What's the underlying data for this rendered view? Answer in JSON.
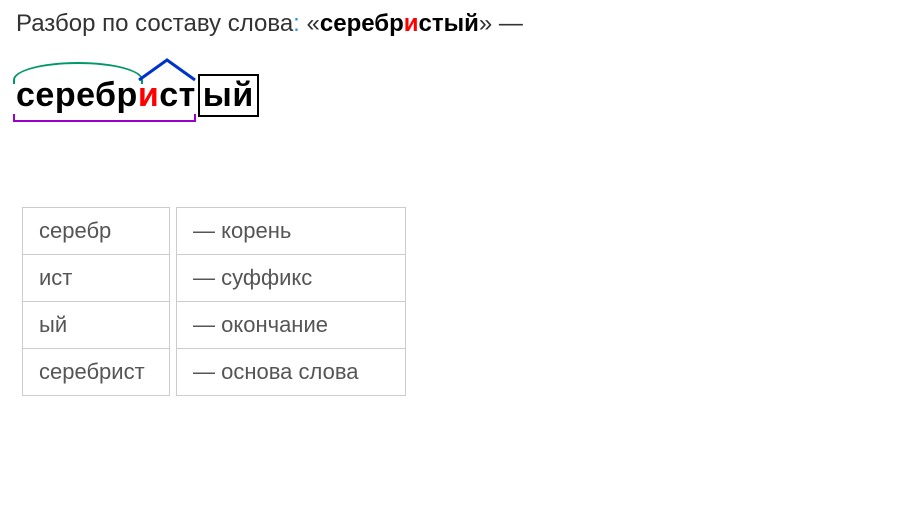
{
  "title": {
    "prefix": "Разбор по составу слова",
    "colon": ":",
    "quote_open": "«",
    "word_part1": "серебр",
    "word_highlight": "и",
    "word_part2": "стый",
    "quote_close": "»",
    "dash": " —"
  },
  "morpheme_display": {
    "root": "серебр",
    "suffix_pre": "",
    "suffix_hi": "и",
    "suffix_post": "ст",
    "ending": "ый"
  },
  "parse_rows": [
    {
      "morph": "серебр",
      "desc": "— корень"
    },
    {
      "morph": "ист",
      "desc": "— суффикс"
    },
    {
      "morph": "ый",
      "desc": "— окончание"
    },
    {
      "morph": "серебрист",
      "desc": "— основа слова"
    }
  ],
  "chart_data": {
    "type": "table",
    "title": "Разбор по составу слова «серебристый»",
    "word": "серебристый",
    "morphemes": [
      {
        "segment": "серебр",
        "type": "корень"
      },
      {
        "segment": "ист",
        "type": "суффикс"
      },
      {
        "segment": "ый",
        "type": "окончание"
      },
      {
        "segment": "серебрист",
        "type": "основа слова"
      }
    ]
  }
}
